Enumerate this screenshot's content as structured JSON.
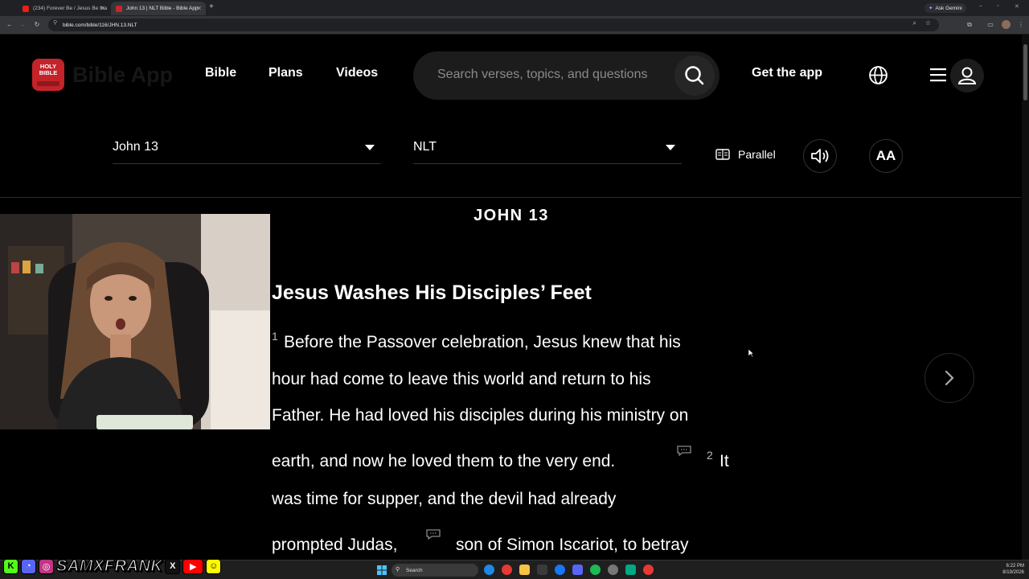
{
  "browser": {
    "tabs": [
      {
        "title": "(234) Forever Be / Jesus Be tha",
        "active": false
      },
      {
        "title": "John 13 | NLT Bible - Bible App",
        "active": true
      }
    ],
    "new_tab": "+",
    "ask_gemini": "Ask Gemini",
    "url": "bible.com/bible/116/JHN.13.NLT",
    "window_controls": [
      "–",
      "▫",
      "✕"
    ]
  },
  "header": {
    "logo_text": "HOLY BIBLE",
    "brand": "Bible App",
    "nav": [
      "Bible",
      "Plans",
      "Videos"
    ],
    "search_placeholder": "Search verses, topics, and questions",
    "get_app": "Get the app"
  },
  "selectors": {
    "book": "John 13",
    "version": "NLT",
    "parallel": "Parallel",
    "font_btn": "AA"
  },
  "content": {
    "chapter_title": "JOHN 13",
    "section_heading": "Jesus Washes His Disciples’ Feet",
    "verse1_num": "1",
    "lines": [
      "Before the Passover celebration, Jesus knew that his",
      "hour had come to leave this world and return to his",
      "Father. He had loved his disciples during his ministry on",
      "earth, and now he loved them to the very end.",
      "was time for supper, and the devil had already",
      "prompted Judas,",
      "son of Simon Iscariot, to betray"
    ],
    "verse2_num": "2",
    "verse2_start": "It"
  },
  "overlay": {
    "handle": "SAMXFRANK"
  },
  "taskbar": {
    "search": "Search",
    "time": "6:22 PM",
    "date": "8/19/2026"
  }
}
